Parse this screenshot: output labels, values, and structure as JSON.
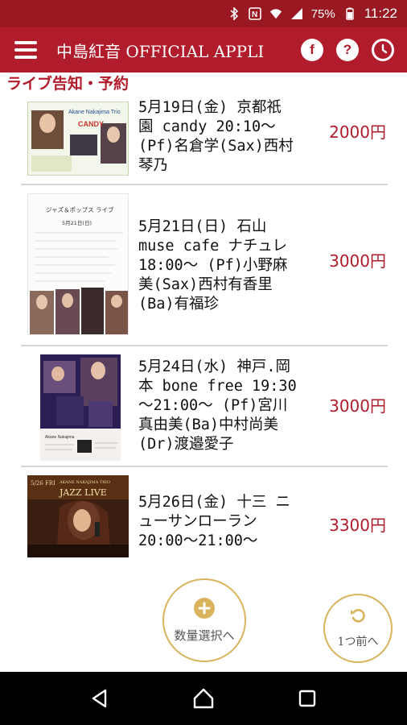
{
  "status_bar": {
    "battery": "75%",
    "time": "11:22"
  },
  "app_bar": {
    "title": "中島紅音 OFFICIAL APPLI",
    "icons": [
      "menu-icon",
      "facebook-icon",
      "help-icon",
      "clock-icon"
    ]
  },
  "section": {
    "title": "ライブ告知・予約"
  },
  "events": [
    {
      "description": "5月19日(金) 京都祇\n園 candy 20:10〜\n(Pf)名倉学(Sax)西村\n琴乃",
      "price": "2000円",
      "flyer_heading": "Akane Nakajima Trio",
      "flyer_venue": "CANDY"
    },
    {
      "description": "5月21日(日) 石山\nmuse cafe ナチュレ\n18:00〜 (Pf)小野麻\n美(Sax)西村有香里\n(Ba)有福珍",
      "price": "3000円",
      "flyer_heading": "ジャズ＆ポップス ライブ",
      "flyer_date": "5月21日(日)"
    },
    {
      "description": "5月24日(水) 神戸.岡\n本 bone free 19:30\n〜21:00〜 (Pf)宮川\n真由美(Ba)中村尚美\n(Dr)渡邉愛子",
      "price": "3000円",
      "flyer_heading": "Akane Nakajima"
    },
    {
      "description": "5月26日(金) 十三 ニ\nューサンローラン\n20:00〜21:00〜",
      "price": "3300円",
      "flyer_date": "5/26 FRI",
      "flyer_heading": "AKANE NAKAJIMA TRIO",
      "flyer_title": "JAZZ LIVE"
    }
  ],
  "actions": {
    "quantity_label": "数量選択へ",
    "back_label": "1つ前へ"
  },
  "colors": {
    "brand": "#b01c2b",
    "accent_gold": "#d9b45c"
  }
}
